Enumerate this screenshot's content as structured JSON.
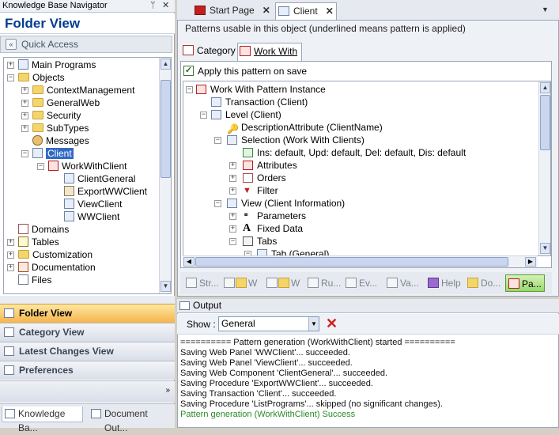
{
  "kb_navigator": {
    "title": "Knowledge Base Navigator",
    "pin_glyph": "ᛘ",
    "close_glyph": "✕",
    "folder_view_title": "Folder View",
    "quick_access": "Quick Access"
  },
  "tree": [
    {
      "label": "Main Programs",
      "icon": "main-programs-icon"
    },
    {
      "label": "Objects",
      "icon": "folder-icon"
    },
    {
      "label": "ContextManagement",
      "icon": "folder-icon"
    },
    {
      "label": "GeneralWeb",
      "icon": "folder-icon"
    },
    {
      "label": "Security",
      "icon": "folder-icon"
    },
    {
      "label": "SubTypes",
      "icon": "folder-icon"
    },
    {
      "label": "Messages",
      "icon": "messages-icon"
    },
    {
      "label": "Client",
      "icon": "transaction-icon",
      "selected": true
    },
    {
      "label": "WorkWithClient",
      "icon": "pattern-icon"
    },
    {
      "label": "ClientGeneral",
      "icon": "webcomponent-icon"
    },
    {
      "label": "ExportWWClient",
      "icon": "procedure-icon"
    },
    {
      "label": "ViewClient",
      "icon": "webpanel-icon"
    },
    {
      "label": "WWClient",
      "icon": "webpanel-icon"
    },
    {
      "label": "Domains",
      "icon": "domains-icon"
    },
    {
      "label": "Tables",
      "icon": "tables-icon"
    },
    {
      "label": "Customization",
      "icon": "folder-icon"
    },
    {
      "label": "Documentation",
      "icon": "documentation-icon"
    },
    {
      "label": "Files",
      "icon": "files-icon"
    }
  ],
  "nav_buttons": [
    {
      "label": "Folder View",
      "active": true
    },
    {
      "label": "Category View"
    },
    {
      "label": "Latest Changes View"
    },
    {
      "label": "Preferences"
    }
  ],
  "bottom_tabs": [
    {
      "label": "Knowledge Ba...",
      "active": true
    },
    {
      "label": "Document Out..."
    }
  ],
  "doc_tabs": [
    {
      "label": "Start Page"
    },
    {
      "label": "Client",
      "active": true
    }
  ],
  "doc_tab_close": "✕",
  "patterns_message": "Patterns usable in this object (underlined means pattern is applied)",
  "pattern_tabs": [
    {
      "label": "Category"
    },
    {
      "label": "Work With",
      "active": true
    }
  ],
  "apply_on_save": {
    "label": "Apply this pattern on save",
    "checked": true
  },
  "pattern_tree": [
    {
      "label": "Work With Pattern Instance"
    },
    {
      "label": "Transaction (Client)"
    },
    {
      "label": "Level (Client)"
    },
    {
      "label": "DescriptionAttribute (ClientName)"
    },
    {
      "label": "Selection (Work With Clients)"
    },
    {
      "label": "Ins: default, Upd: default, Del: default, Dis: default"
    },
    {
      "label": "Attributes"
    },
    {
      "label": "Orders"
    },
    {
      "label": "Filter"
    },
    {
      "label": "View (Client Information)"
    },
    {
      "label": "Parameters"
    },
    {
      "label": "Fixed Data"
    },
    {
      "label": "Tabs"
    },
    {
      "label": "Tab (General)"
    }
  ],
  "editor_tools": [
    {
      "label": "Str..."
    },
    {
      "label": "W"
    },
    {
      "label": "W"
    },
    {
      "label": "Ru..."
    },
    {
      "label": "Ev..."
    },
    {
      "label": "Va..."
    },
    {
      "label": "Help"
    },
    {
      "label": "Do..."
    },
    {
      "label": "Pa...",
      "active": true
    }
  ],
  "output": {
    "title": "Output",
    "show_label": "Show :",
    "show_value": "General",
    "lines": [
      {
        "text": "========== Pattern generation (WorkWithClient) started =========="
      },
      {
        "text": "Saving Web Panel 'WWClient'... succeeded."
      },
      {
        "text": "Saving Web Panel 'ViewClient'... succeeded."
      },
      {
        "text": "Saving Web Component 'ClientGeneral'... succeeded."
      },
      {
        "text": "Saving Procedure 'ExportWWClient'... succeeded."
      },
      {
        "text": "Saving Transaction 'Client'... succeeded."
      },
      {
        "text": "Saving Procedure 'ListPrograms'... skipped (no significant changes)."
      },
      {
        "text": "Pattern generation (WorkWithClient) Success",
        "status": "success"
      }
    ]
  },
  "colors": {
    "selection": "#316ac5",
    "active_nav": "#f6b44a",
    "success_text": "#2a8a2a",
    "title_blue": "#003d8f"
  }
}
